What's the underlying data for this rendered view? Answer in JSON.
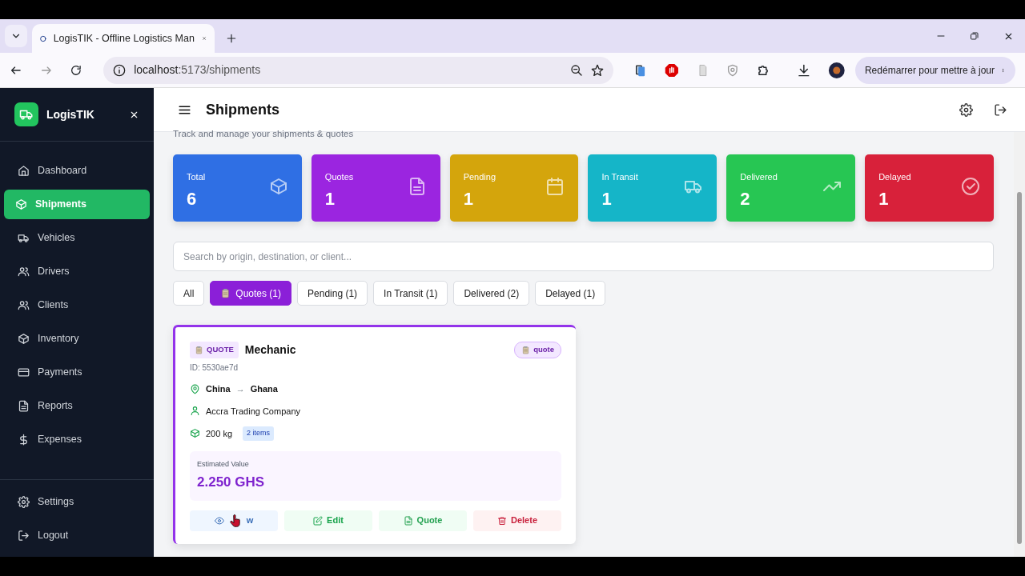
{
  "browser": {
    "tab_title": "LogisTIK - Offline Logistics Man",
    "url_host": "localhost",
    "url_path": ":5173/shipments",
    "update_button": "Redémarrer pour mettre à jour"
  },
  "sidebar": {
    "brand": "LogisTIK",
    "items": [
      {
        "label": "Dashboard",
        "selected": false
      },
      {
        "label": "Shipments",
        "selected": true
      },
      {
        "label": "Vehicles",
        "selected": false
      },
      {
        "label": "Drivers",
        "selected": false
      },
      {
        "label": "Clients",
        "selected": false
      },
      {
        "label": "Inventory",
        "selected": false
      },
      {
        "label": "Payments",
        "selected": false
      },
      {
        "label": "Reports",
        "selected": false
      },
      {
        "label": "Expenses",
        "selected": false
      }
    ],
    "bottom_items": [
      {
        "label": "Settings"
      },
      {
        "label": "Logout"
      }
    ]
  },
  "header": {
    "title": "Shipments"
  },
  "subtitle": "Track and manage your shipments & quotes",
  "stats": [
    {
      "label": "Total",
      "value": "6",
      "color": "#2f6fe4"
    },
    {
      "label": "Quotes",
      "value": "1",
      "color": "#9b25e0"
    },
    {
      "label": "Pending",
      "value": "1",
      "color": "#d4a50c"
    },
    {
      "label": "In Transit",
      "value": "1",
      "color": "#15b5c8"
    },
    {
      "label": "Delivered",
      "value": "2",
      "color": "#27c653"
    },
    {
      "label": "Delayed",
      "value": "1",
      "color": "#d8213a"
    }
  ],
  "search": {
    "placeholder": "Search by origin, destination, or client..."
  },
  "filters": [
    {
      "label": "All",
      "selected": false,
      "icon": false
    },
    {
      "label": "Quotes (1)",
      "selected": true,
      "icon": true
    },
    {
      "label": "Pending (1)",
      "selected": false,
      "icon": false
    },
    {
      "label": "In Transit (1)",
      "selected": false,
      "icon": false
    },
    {
      "label": "Delivered (2)",
      "selected": false,
      "icon": false
    },
    {
      "label": "Delayed (1)",
      "selected": false,
      "icon": false
    }
  ],
  "shipments": [
    {
      "badge": "QUOTE",
      "title": "Mechanic",
      "id": "ID: 5530ae7d",
      "status": "quote",
      "origin": "China",
      "arrow": "→",
      "destination": "Ghana",
      "client": "Accra Trading Company",
      "weight": "200 kg",
      "items": "2 items",
      "value_label": "Estimated Value",
      "value": "2.250 GHS",
      "actions": [
        {
          "kind": "view",
          "label": "w"
        },
        {
          "kind": "edit",
          "label": "Edit"
        },
        {
          "kind": "quote",
          "label": "Quote"
        },
        {
          "kind": "delete",
          "label": "Delete"
        }
      ]
    }
  ]
}
